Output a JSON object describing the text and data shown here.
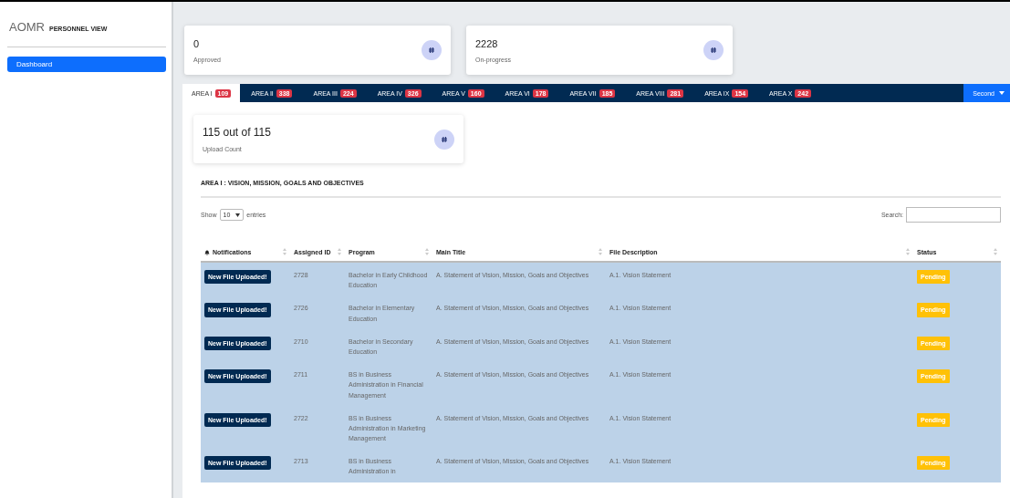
{
  "sidebar": {
    "logo": "AOMR",
    "subtitle": "PERSONNEL VIEW",
    "items": [
      {
        "label": "Dashboard",
        "selected": true
      }
    ]
  },
  "stats": [
    {
      "value": "0",
      "label": "Approved"
    },
    {
      "value": "2228",
      "label": "On-progress"
    }
  ],
  "tabs": [
    {
      "label": "AREA I",
      "count": "109",
      "selected": true
    },
    {
      "label": "AREA II",
      "count": "338",
      "selected": false
    },
    {
      "label": "AREA III",
      "count": "224",
      "selected": false
    },
    {
      "label": "AREA IV",
      "count": "326",
      "selected": false
    },
    {
      "label": "AREA V",
      "count": "160",
      "selected": false
    },
    {
      "label": "AREA VI",
      "count": "178",
      "selected": false
    },
    {
      "label": "AREA VII",
      "count": "185",
      "selected": false
    },
    {
      "label": "AREA VIII",
      "count": "281",
      "selected": false
    },
    {
      "label": "AREA IX",
      "count": "154",
      "selected": false
    },
    {
      "label": "AREA X",
      "count": "242",
      "selected": false
    }
  ],
  "semester_dropdown": {
    "value": "Second"
  },
  "upload_card": {
    "value": "115 out of 115",
    "label": "Upload Count"
  },
  "section_title": "AREA I : VISION, MISSION, GOALS AND OBJECTIVES",
  "table_controls": {
    "show_label": "Show",
    "entries_value": "10",
    "entries_label": "entries",
    "search_label": "Search:"
  },
  "table": {
    "columns": [
      "Notifications",
      "Assigned ID",
      "Program",
      "Main Title",
      "File Description",
      "Status"
    ],
    "rows": [
      {
        "notification": "New File Uploaded!",
        "id": "2728",
        "program": "Bachelor in Early Childhood Education",
        "main_title": "A. Statement of Vision, Mission, Goals and Objectives",
        "file_description": "A.1. Vision Statement",
        "status": "Pending"
      },
      {
        "notification": "New File Uploaded!",
        "id": "2726",
        "program": "Bachelor in Elementary Education",
        "main_title": "A. Statement of Vision, Mission, Goals and Objectives",
        "file_description": "A.1. Vision Statement",
        "status": "Pending"
      },
      {
        "notification": "New File Uploaded!",
        "id": "2710",
        "program": "Bachelor in Secondary Education",
        "main_title": "A. Statement of Vision, Mission, Goals and Objectives",
        "file_description": "A.1. Vision Statement",
        "status": "Pending"
      },
      {
        "notification": "New File Uploaded!",
        "id": "2711",
        "program": "BS in Business Administration in Financial Management",
        "main_title": "A. Statement of Vision, Mission, Goals and Objectives",
        "file_description": "A.1. Vision Statement",
        "status": "Pending"
      },
      {
        "notification": "New File Uploaded!",
        "id": "2722",
        "program": "BS in Business Administration in Marketing Management",
        "main_title": "A. Statement of Vision, Mission, Goals and Objectives",
        "file_description": "A.1. Vision Statement",
        "status": "Pending"
      },
      {
        "notification": "New File Uploaded!",
        "id": "2713",
        "program": "BS in Business Administration in",
        "main_title": "A. Statement of Vision, Mission, Goals and Objectives",
        "file_description": "A.1. Vision Statement",
        "status": "Pending"
      }
    ]
  }
}
